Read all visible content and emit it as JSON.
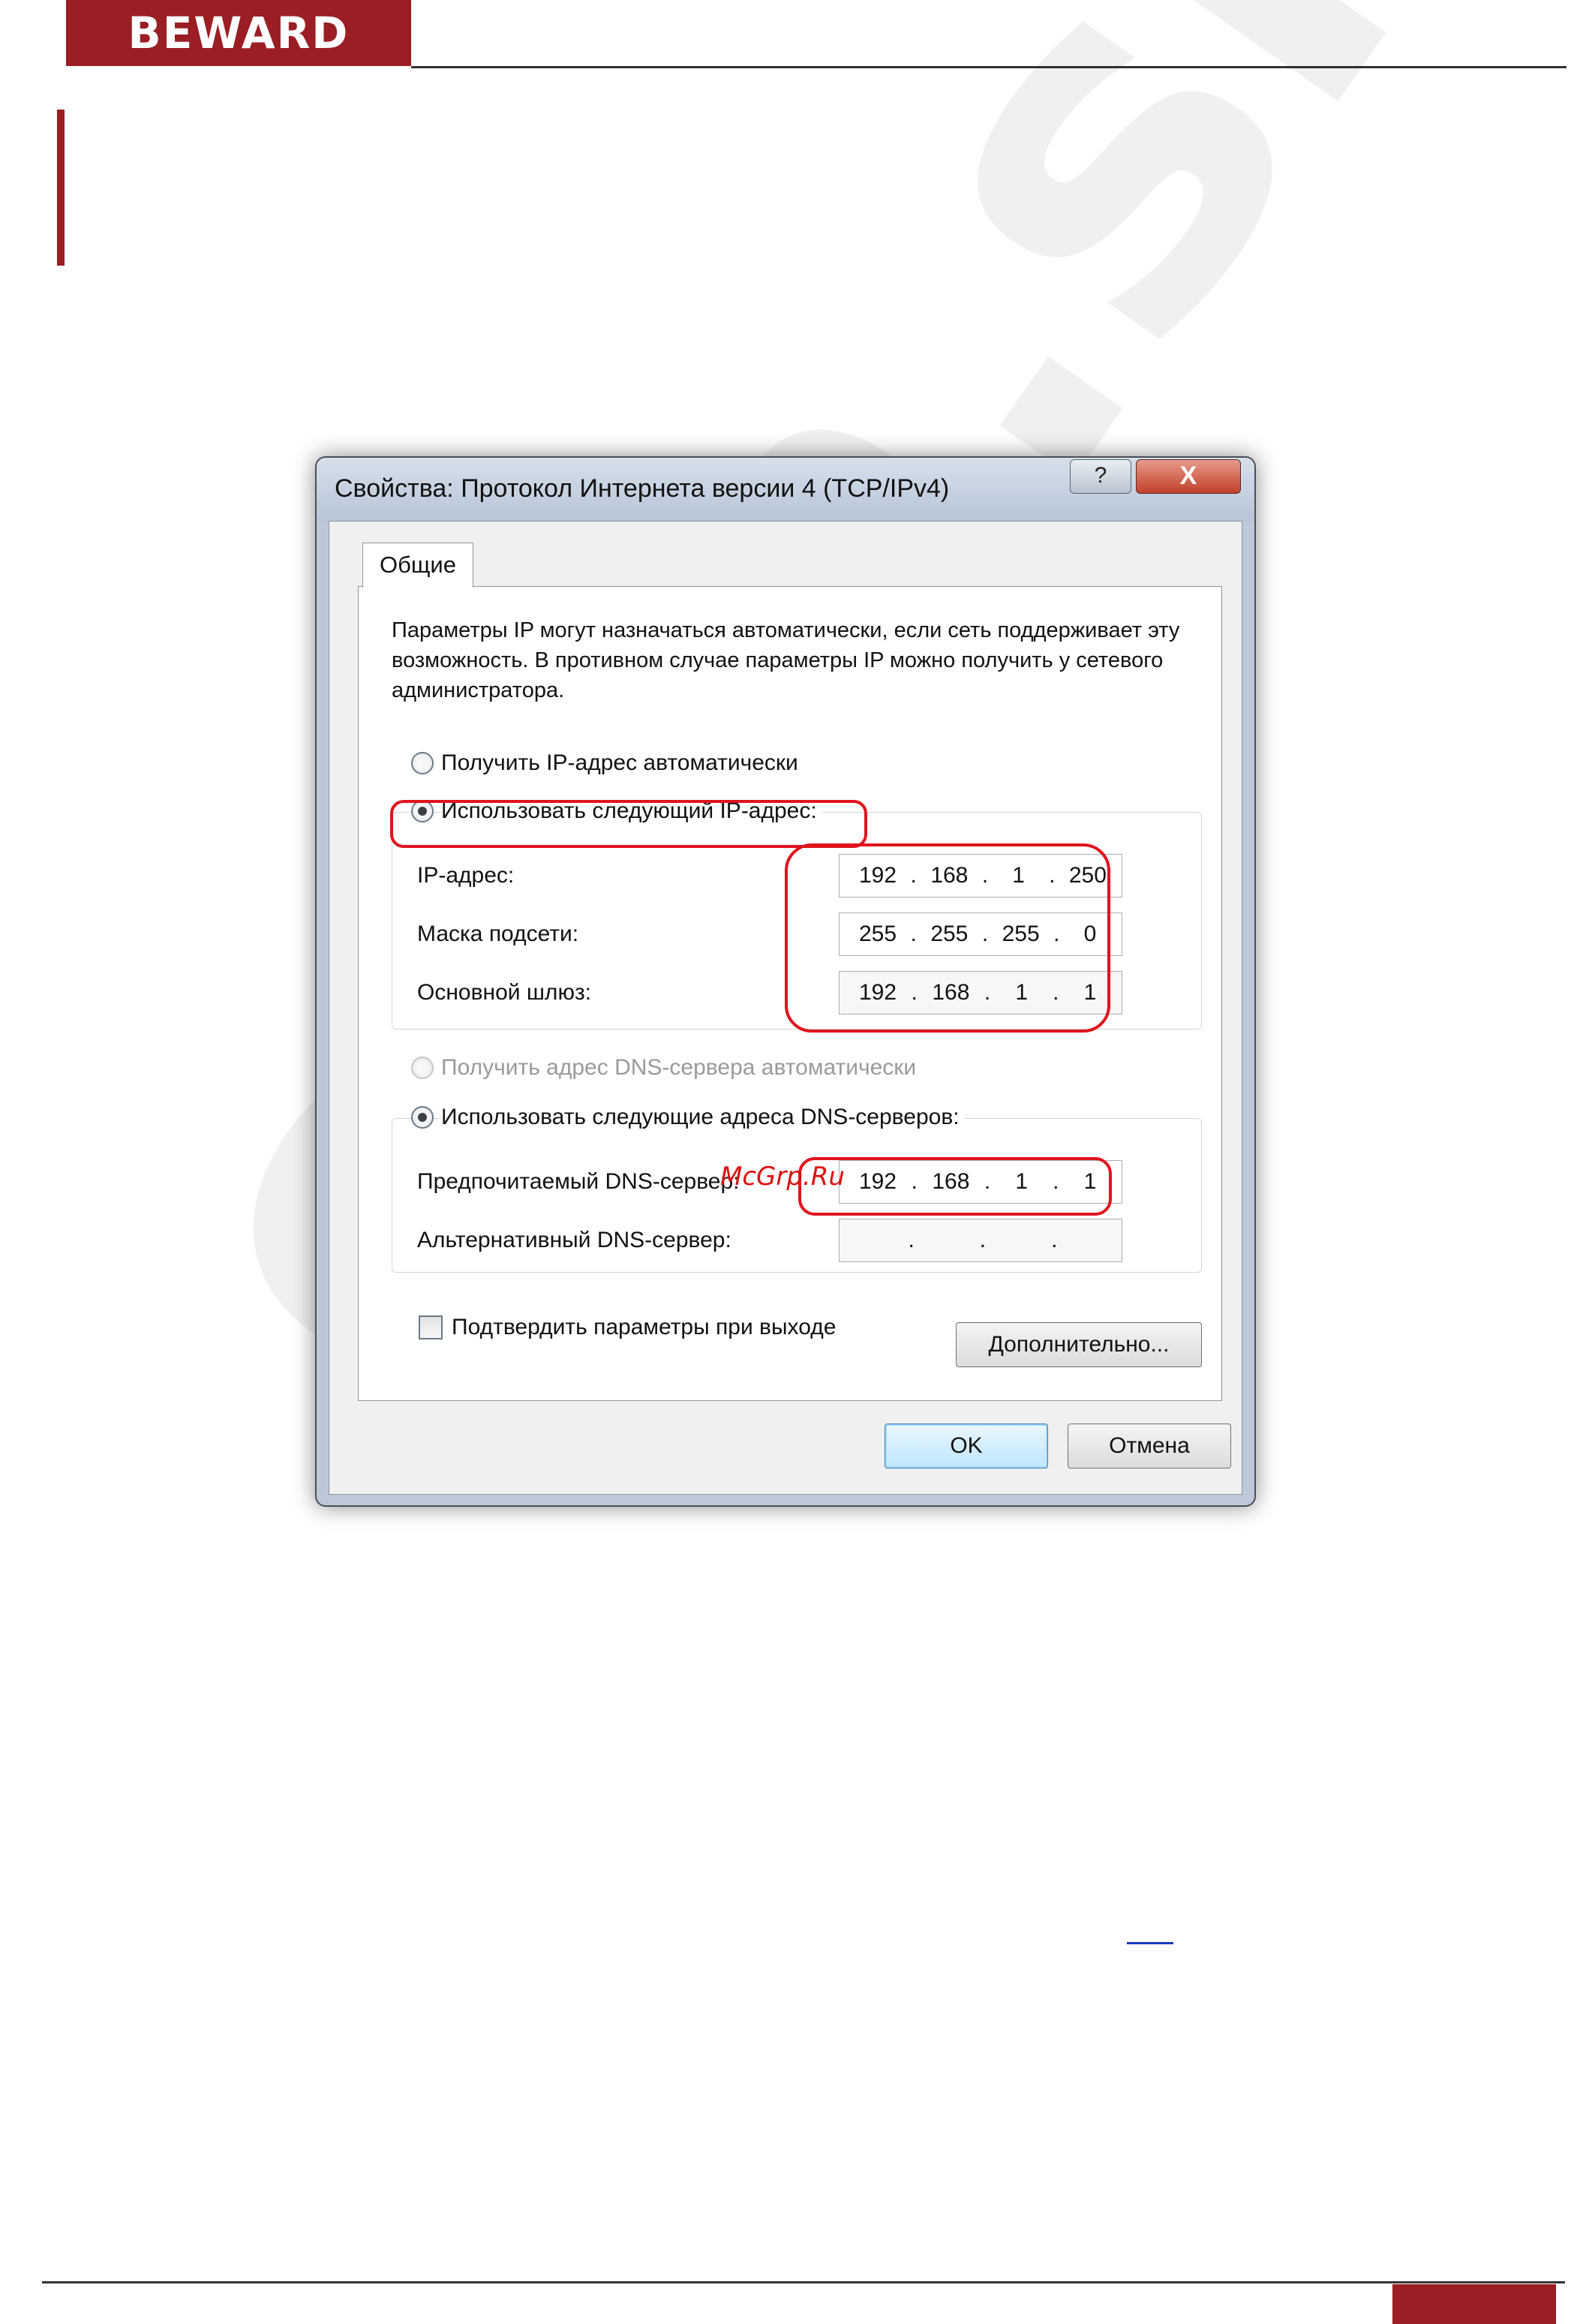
{
  "page": {
    "brand": "BEWARD",
    "watermark": "cam.sive",
    "overlay_mark": "McGrp.Ru"
  },
  "dialog": {
    "title": "Свойства: Протокол Интернета версии 4 (TCP/IPv4)",
    "help_label": "?",
    "close_label": "X",
    "tab_label": "Общие",
    "description": "Параметры IP могут назначаться автоматически, если сеть поддерживает эту возможность. В противном случае параметры IP можно получить у сетевого администратора.",
    "ip_section": {
      "auto_label": "Получить IP-адрес автоматически",
      "manual_label": "Использовать следующий IP-адрес:",
      "selected": "manual",
      "fields": [
        {
          "label": "IP-адрес:",
          "octets": [
            "192",
            "168",
            "1",
            "250"
          ]
        },
        {
          "label": "Маска подсети:",
          "octets": [
            "255",
            "255",
            "255",
            "0"
          ]
        },
        {
          "label": "Основной шлюз:",
          "octets": [
            "192",
            "168",
            "1",
            "1"
          ]
        }
      ]
    },
    "dns_section": {
      "auto_label": "Получить адрес DNS-сервера автоматически",
      "manual_label": "Использовать следующие адреса DNS-серверов:",
      "selected": "manual",
      "fields": [
        {
          "label": "Предпочитаемый DNS-сервер:",
          "octets": [
            "192",
            "168",
            "1",
            "1"
          ]
        },
        {
          "label": "Альтернативный DNS-сервер:",
          "octets": [
            "",
            "",
            "",
            ""
          ]
        }
      ]
    },
    "validate_label": "Подтвердить параметры при выходе",
    "validate_checked": false,
    "advanced_label": "Дополнительно...",
    "ok_label": "OK",
    "cancel_label": "Отмена"
  },
  "colors": {
    "brand_red": "#9b1e24",
    "annotation_red": "#e0141e"
  }
}
